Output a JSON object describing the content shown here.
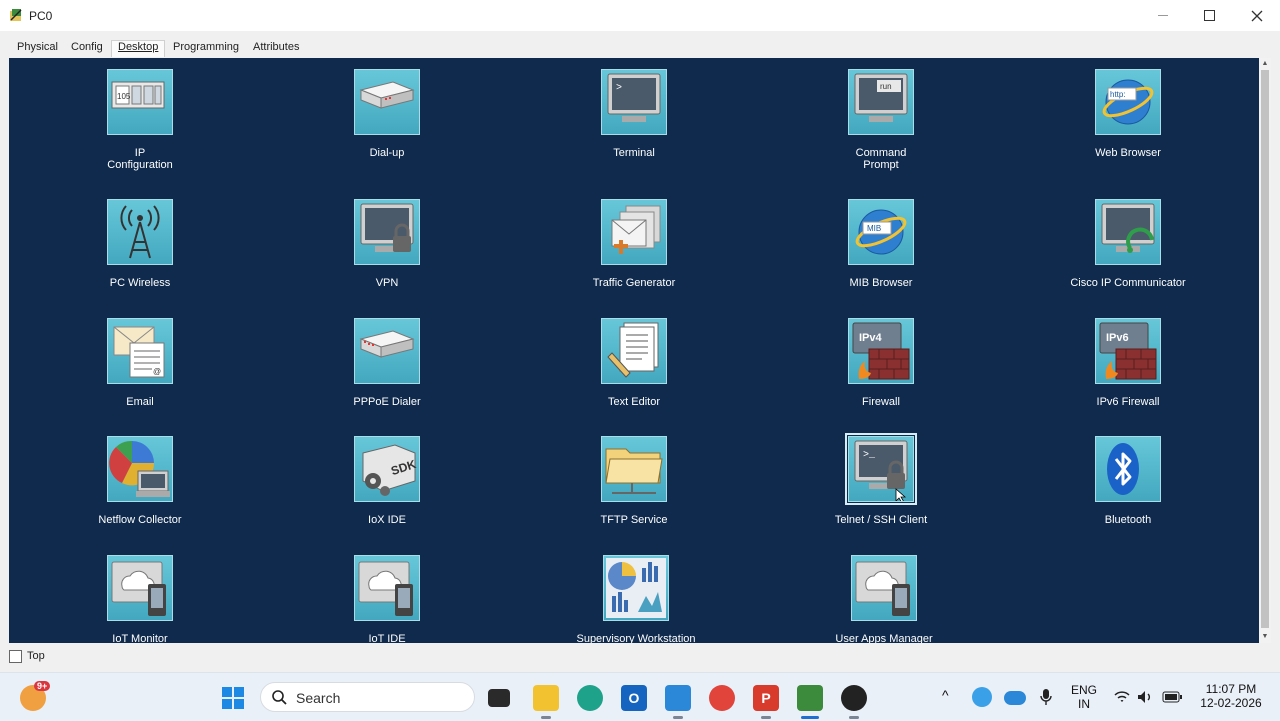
{
  "window": {
    "title": "PC0",
    "minimize_icon": "minimize-icon",
    "maximize_icon": "maximize-icon",
    "close_icon": "close-icon"
  },
  "tabs": [
    "Physical",
    "Config",
    "Desktop",
    "Programming",
    "Attributes"
  ],
  "active_tab": "Desktop",
  "apps": [
    {
      "label": "IP\nConfiguration",
      "icon": "ip-configuration-icon"
    },
    {
      "label": "Dial-up",
      "icon": "modem-icon"
    },
    {
      "label": "Terminal",
      "icon": "terminal-icon"
    },
    {
      "label": "Command\nPrompt",
      "icon": "command-prompt-icon"
    },
    {
      "label": "Web Browser",
      "icon": "web-browser-icon"
    },
    {
      "label": "PC Wireless",
      "icon": "wireless-antenna-icon"
    },
    {
      "label": "VPN",
      "icon": "vpn-lock-icon"
    },
    {
      "label": "Traffic Generator",
      "icon": "traffic-generator-icon"
    },
    {
      "label": "MIB Browser",
      "icon": "mib-browser-icon"
    },
    {
      "label": "Cisco IP Communicator",
      "icon": "ip-communicator-icon"
    },
    {
      "label": "Email",
      "icon": "email-icon"
    },
    {
      "label": "PPPoE Dialer",
      "icon": "pppoe-dialer-icon"
    },
    {
      "label": "Text Editor",
      "icon": "text-editor-icon"
    },
    {
      "label": "Firewall",
      "icon": "ipv4-firewall-icon"
    },
    {
      "label": "IPv6 Firewall",
      "icon": "ipv6-firewall-icon"
    },
    {
      "label": "Netflow Collector",
      "icon": "netflow-collector-icon"
    },
    {
      "label": "IoX IDE",
      "icon": "iox-sdk-icon"
    },
    {
      "label": "TFTP Service",
      "icon": "tftp-folder-icon"
    },
    {
      "label": "Telnet / SSH Client",
      "icon": "telnet-ssh-icon"
    },
    {
      "label": "Bluetooth",
      "icon": "bluetooth-icon"
    },
    {
      "label": "IoT Monitor",
      "icon": "iot-monitor-icon"
    },
    {
      "label": "IoT IDE",
      "icon": "iot-ide-icon"
    },
    {
      "label": "Supervisory Workstation",
      "icon": "supervisory-workstation-icon"
    },
    {
      "label": "User Apps Manager",
      "icon": "user-apps-manager-icon"
    }
  ],
  "icon_text": {
    "ip_config": "105",
    "command_prompt": "run",
    "web_browser": "http:",
    "mib": "MIB",
    "ipv4": "IPv4",
    "ipv6": "IPv6",
    "sdk": "SDK"
  },
  "bottom": {
    "top_checkbox_label": "Top",
    "top_checked": false
  },
  "taskbar": {
    "search_placeholder": "Search",
    "notification_badge": "9+",
    "language_line1": "ENG",
    "language_line2": "IN",
    "time": "11:07 PM",
    "date": "12-02-2026"
  },
  "colors": {
    "desktop_bg": "#0f2a4c",
    "icon_tile": "#54b8cc",
    "accent": "#1e88e5"
  }
}
